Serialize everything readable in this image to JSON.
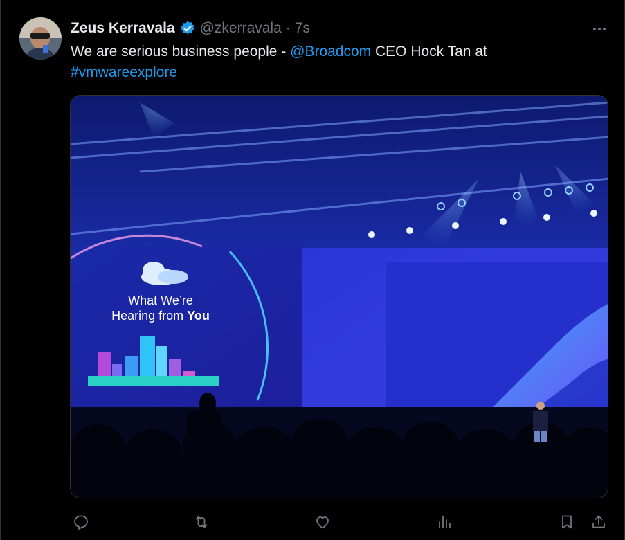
{
  "author": {
    "display_name": "Zeus Kerravala",
    "handle": "@zkerravala",
    "separator": "·",
    "timestamp": "7s",
    "verified": true
  },
  "tweet": {
    "text_part1": "We are serious business people - ",
    "mention": "@Broadcom",
    "text_part2": " CEO Hock Tan at",
    "hashtag": "#vmwareexplore"
  },
  "media": {
    "screen_line1": "What We’re",
    "screen_line2_prefix": "Hearing from ",
    "screen_line2_bold": "You"
  },
  "actions": {
    "reply_icon": "reply-icon",
    "retweet_icon": "retweet-icon",
    "like_icon": "heart-icon",
    "views_icon": "views-icon",
    "bookmark_icon": "bookmark-icon",
    "share_icon": "share-icon"
  },
  "colors": {
    "link": "#1d9bf0",
    "muted": "#71767b",
    "text": "#e7e9ea",
    "background": "#000000"
  }
}
